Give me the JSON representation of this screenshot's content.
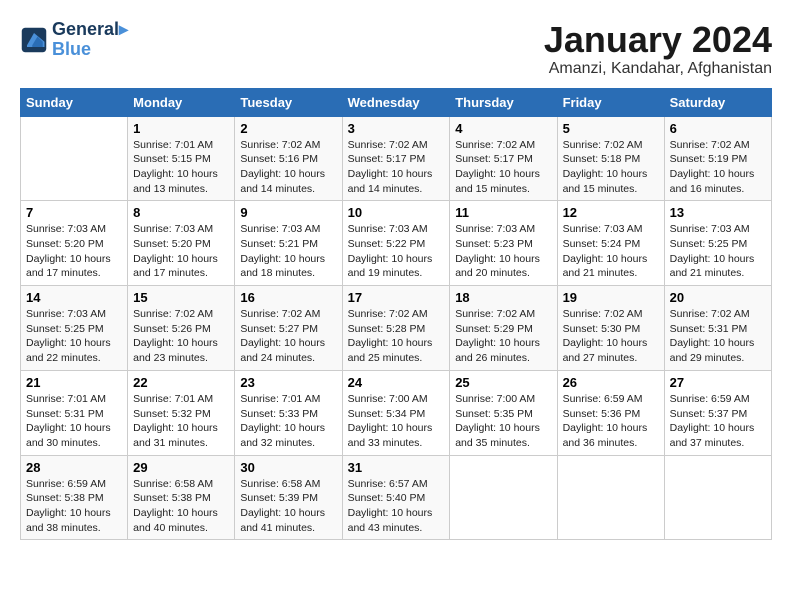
{
  "logo": {
    "line1": "General",
    "line2": "Blue"
  },
  "title": "January 2024",
  "subtitle": "Amanzi, Kandahar, Afghanistan",
  "headers": [
    "Sunday",
    "Monday",
    "Tuesday",
    "Wednesday",
    "Thursday",
    "Friday",
    "Saturday"
  ],
  "weeks": [
    [
      {
        "day": "",
        "info": ""
      },
      {
        "day": "1",
        "info": "Sunrise: 7:01 AM\nSunset: 5:15 PM\nDaylight: 10 hours\nand 13 minutes."
      },
      {
        "day": "2",
        "info": "Sunrise: 7:02 AM\nSunset: 5:16 PM\nDaylight: 10 hours\nand 14 minutes."
      },
      {
        "day": "3",
        "info": "Sunrise: 7:02 AM\nSunset: 5:17 PM\nDaylight: 10 hours\nand 14 minutes."
      },
      {
        "day": "4",
        "info": "Sunrise: 7:02 AM\nSunset: 5:17 PM\nDaylight: 10 hours\nand 15 minutes."
      },
      {
        "day": "5",
        "info": "Sunrise: 7:02 AM\nSunset: 5:18 PM\nDaylight: 10 hours\nand 15 minutes."
      },
      {
        "day": "6",
        "info": "Sunrise: 7:02 AM\nSunset: 5:19 PM\nDaylight: 10 hours\nand 16 minutes."
      }
    ],
    [
      {
        "day": "7",
        "info": "Sunrise: 7:03 AM\nSunset: 5:20 PM\nDaylight: 10 hours\nand 17 minutes."
      },
      {
        "day": "8",
        "info": "Sunrise: 7:03 AM\nSunset: 5:20 PM\nDaylight: 10 hours\nand 17 minutes."
      },
      {
        "day": "9",
        "info": "Sunrise: 7:03 AM\nSunset: 5:21 PM\nDaylight: 10 hours\nand 18 minutes."
      },
      {
        "day": "10",
        "info": "Sunrise: 7:03 AM\nSunset: 5:22 PM\nDaylight: 10 hours\nand 19 minutes."
      },
      {
        "day": "11",
        "info": "Sunrise: 7:03 AM\nSunset: 5:23 PM\nDaylight: 10 hours\nand 20 minutes."
      },
      {
        "day": "12",
        "info": "Sunrise: 7:03 AM\nSunset: 5:24 PM\nDaylight: 10 hours\nand 21 minutes."
      },
      {
        "day": "13",
        "info": "Sunrise: 7:03 AM\nSunset: 5:25 PM\nDaylight: 10 hours\nand 21 minutes."
      }
    ],
    [
      {
        "day": "14",
        "info": "Sunrise: 7:03 AM\nSunset: 5:25 PM\nDaylight: 10 hours\nand 22 minutes."
      },
      {
        "day": "15",
        "info": "Sunrise: 7:02 AM\nSunset: 5:26 PM\nDaylight: 10 hours\nand 23 minutes."
      },
      {
        "day": "16",
        "info": "Sunrise: 7:02 AM\nSunset: 5:27 PM\nDaylight: 10 hours\nand 24 minutes."
      },
      {
        "day": "17",
        "info": "Sunrise: 7:02 AM\nSunset: 5:28 PM\nDaylight: 10 hours\nand 25 minutes."
      },
      {
        "day": "18",
        "info": "Sunrise: 7:02 AM\nSunset: 5:29 PM\nDaylight: 10 hours\nand 26 minutes."
      },
      {
        "day": "19",
        "info": "Sunrise: 7:02 AM\nSunset: 5:30 PM\nDaylight: 10 hours\nand 27 minutes."
      },
      {
        "day": "20",
        "info": "Sunrise: 7:02 AM\nSunset: 5:31 PM\nDaylight: 10 hours\nand 29 minutes."
      }
    ],
    [
      {
        "day": "21",
        "info": "Sunrise: 7:01 AM\nSunset: 5:31 PM\nDaylight: 10 hours\nand 30 minutes."
      },
      {
        "day": "22",
        "info": "Sunrise: 7:01 AM\nSunset: 5:32 PM\nDaylight: 10 hours\nand 31 minutes."
      },
      {
        "day": "23",
        "info": "Sunrise: 7:01 AM\nSunset: 5:33 PM\nDaylight: 10 hours\nand 32 minutes."
      },
      {
        "day": "24",
        "info": "Sunrise: 7:00 AM\nSunset: 5:34 PM\nDaylight: 10 hours\nand 33 minutes."
      },
      {
        "day": "25",
        "info": "Sunrise: 7:00 AM\nSunset: 5:35 PM\nDaylight: 10 hours\nand 35 minutes."
      },
      {
        "day": "26",
        "info": "Sunrise: 6:59 AM\nSunset: 5:36 PM\nDaylight: 10 hours\nand 36 minutes."
      },
      {
        "day": "27",
        "info": "Sunrise: 6:59 AM\nSunset: 5:37 PM\nDaylight: 10 hours\nand 37 minutes."
      }
    ],
    [
      {
        "day": "28",
        "info": "Sunrise: 6:59 AM\nSunset: 5:38 PM\nDaylight: 10 hours\nand 38 minutes."
      },
      {
        "day": "29",
        "info": "Sunrise: 6:58 AM\nSunset: 5:38 PM\nDaylight: 10 hours\nand 40 minutes."
      },
      {
        "day": "30",
        "info": "Sunrise: 6:58 AM\nSunset: 5:39 PM\nDaylight: 10 hours\nand 41 minutes."
      },
      {
        "day": "31",
        "info": "Sunrise: 6:57 AM\nSunset: 5:40 PM\nDaylight: 10 hours\nand 43 minutes."
      },
      {
        "day": "",
        "info": ""
      },
      {
        "day": "",
        "info": ""
      },
      {
        "day": "",
        "info": ""
      }
    ]
  ]
}
